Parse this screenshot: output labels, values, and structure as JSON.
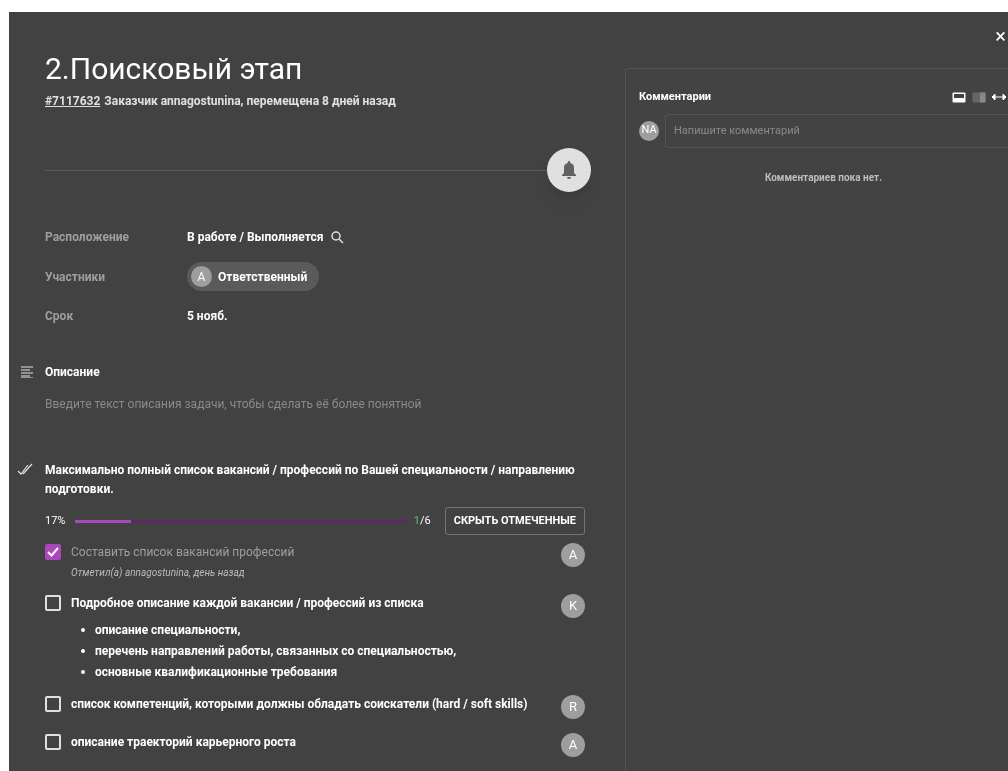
{
  "close": "×",
  "title": "2.Поисковый этап",
  "meta": {
    "id": "#7117632",
    "text": "Заказчик annagostunina, перемещена 8 дней назад"
  },
  "fields": [
    {
      "label": "Расположение",
      "kind": "location",
      "value": "В работе / Выполняется"
    },
    {
      "label": "Участники",
      "kind": "member",
      "avatar": "A",
      "value": "Ответственный"
    },
    {
      "label": "Срок",
      "kind": "text",
      "value": "5 нояб."
    }
  ],
  "description": {
    "title": "Описание",
    "placeholder": "Введите текст описания задачи, чтобы сделать её более понятной"
  },
  "checklist": {
    "title": "Максимально полный список вакансий / профессий по Вашей специальности / направлению подготовки.",
    "percent": "17%",
    "level": 0.17,
    "done": "1",
    "total": "/6",
    "hide_button": "СКРЫТЬ ОТМЕЧЕННЫЕ",
    "items": [
      {
        "text": "Составить список вакансий профессий",
        "checked": true,
        "note": "Отметил(а) annagostunina, день назад",
        "avatar": "A"
      },
      {
        "text": "Подробное описание каждой вакансии / профессий из списка",
        "checked": false,
        "avatar": "K",
        "children": [
          {
            "text": "описание специальности,"
          },
          {
            "text": "перечень направлений работы, связанных со специальностью,"
          },
          {
            "text": "основные квалификационные требования"
          }
        ]
      },
      {
        "text": "список компетенций, которыми должны обладать соискатели (hard / soft skills)",
        "checked": false,
        "avatar": "R"
      },
      {
        "text": "описание траекторий карьерного роста",
        "checked": false,
        "avatar": "A"
      }
    ]
  },
  "comments": {
    "title": "Комментарии",
    "avatar": "NA",
    "placeholder": "Напишите комментарий",
    "empty": "Комментариев пока нет."
  }
}
